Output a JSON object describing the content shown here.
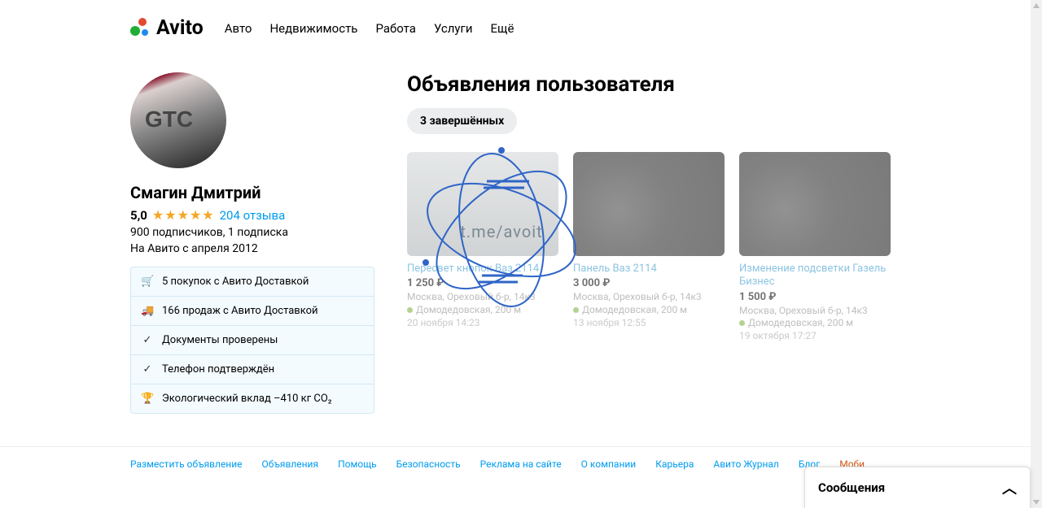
{
  "logo_text": "Avito",
  "nav": [
    "Авто",
    "Недвижимость",
    "Работа",
    "Услуги",
    "Ещё"
  ],
  "profile": {
    "name": "Смагин Дмитрий",
    "rating": "5,0",
    "reviews": "204 отзыва",
    "subscribers": "900 подписчиков, 1 подписка",
    "since": "На Авито с апреля 2012",
    "badges": [
      "5 покупок с Авито Доставкой",
      "166 продаж с Авито Доставкой",
      "Документы проверены",
      "Телефон подтверждён",
      "Экологический вклад –410 кг CO₂"
    ]
  },
  "listings_heading": "Объявления пользователя",
  "pill": "3 завершённых",
  "cards": [
    {
      "title": "Пересвет кнопок Ваз 2114",
      "price": "1 250 ₽",
      "addr": "Москва, Ореховый б-р, 14к3",
      "metro": "Домодедовская, 200 м",
      "time": "20 ноября 14:23"
    },
    {
      "title": "Панель Ваз 2114",
      "price": "3 000 ₽",
      "addr": "Москва, Ореховый б-р, 14к3",
      "metro": "Домодедовская, 200 м",
      "time": "13 ноября 12:55"
    },
    {
      "title": "Изменение подсветки Газель Бизнес",
      "price": "1 500 ₽",
      "addr": "Москва, Ореховый б-р, 14к3",
      "metro": "Домодедовская, 200 м",
      "time": "19 октября 17:27"
    }
  ],
  "watermark": "t.me/avoit",
  "footer": [
    "Разместить объявление",
    "Объявления",
    "Помощь",
    "Безопасность",
    "Реклама на сайте",
    "О компании",
    "Карьера",
    "Авито Журнал",
    "Блог",
    "Моби"
  ],
  "messages": "Сообщения"
}
